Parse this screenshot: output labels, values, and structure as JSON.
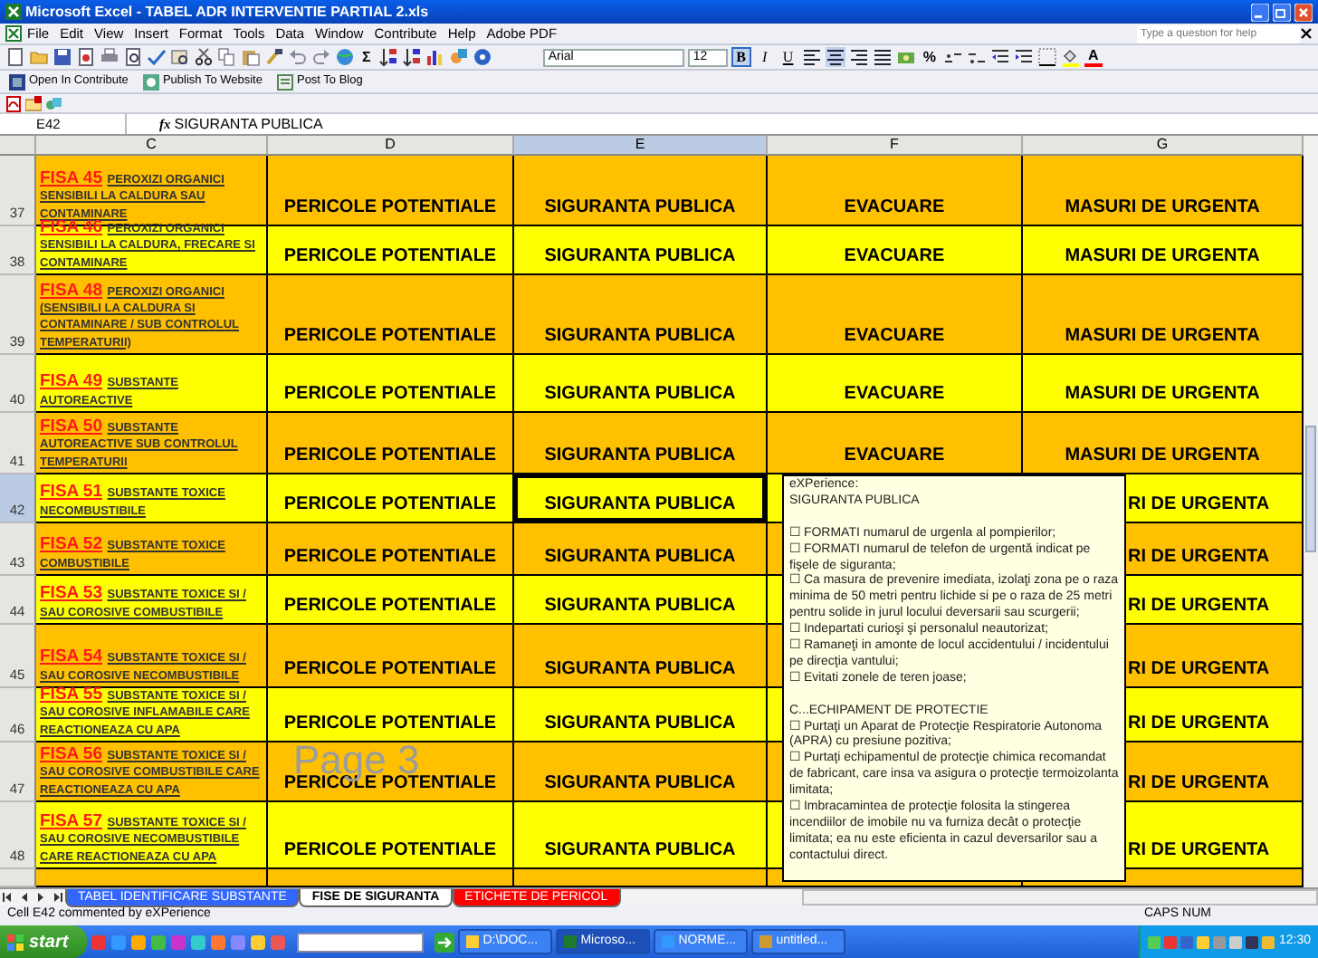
{
  "window": {
    "title": "Microsoft Excel - TABEL ADR INTERVENTIE PARTIAL 2.xls"
  },
  "menu": [
    "File",
    "Edit",
    "View",
    "Insert",
    "Format",
    "Tools",
    "Data",
    "Window",
    "Contribute",
    "Help",
    "Adobe PDF"
  ],
  "help_search": {
    "placeholder": "Type a question for help"
  },
  "toolbar": {
    "sum": "Σ",
    "font": "Arial",
    "size": "12",
    "format_buttons": [
      {
        "label": "B",
        "selected": true
      },
      {
        "label": "I",
        "selected": false
      },
      {
        "label": "U",
        "selected": false
      }
    ],
    "percent": "%",
    "font_color": "A"
  },
  "contribute_toolbar": [
    "Open In Contribute",
    "Publish To Website",
    "Post To Blog"
  ],
  "formula_bar": {
    "name_box": "E42",
    "fx": "fx",
    "value": "SIGURANTA PUBLICA"
  },
  "columns": [
    {
      "label": "C",
      "selected": false
    },
    {
      "label": "D",
      "selected": false
    },
    {
      "label": "E",
      "selected": true
    },
    {
      "label": "F",
      "selected": false
    },
    {
      "label": "G",
      "selected": false
    }
  ],
  "rows": [
    {
      "number": "37",
      "selected": false,
      "color": "#ffc000",
      "fisa": "FISA 45",
      "substance": "PEROXIZI ORGANICI SENSIBILI LA CALDURA SAU CONTAMINARE",
      "cells": [
        "PERICOLE POTENTIALE",
        "SIGURANTA PUBLICA",
        "EVACUARE",
        "MASURI DE URGENTA"
      ]
    },
    {
      "number": "38",
      "selected": false,
      "color": "#ffff00",
      "fisa": "FISA 46",
      "substance": "PEROXIZI ORGANICI SENSIBILI LA CALDURA, FRECARE SI CONTAMINARE",
      "cells": [
        "PERICOLE POTENTIALE",
        "SIGURANTA PUBLICA",
        "EVACUARE",
        "MASURI DE URGENTA"
      ]
    },
    {
      "number": "39",
      "selected": false,
      "color": "#ffc000",
      "fisa": "FISA 48",
      "substance": "PEROXIZI ORGANICI (SENSIBILI LA CALDURA SI CONTAMINARE / SUB CONTROLUL TEMPERATURII)",
      "cells": [
        "PERICOLE POTENTIALE",
        "SIGURANTA PUBLICA",
        "EVACUARE",
        "MASURI DE URGENTA"
      ]
    },
    {
      "number": "40",
      "selected": false,
      "color": "#ffff00",
      "fisa": "FISA 49",
      "substance": "SUBSTANTE AUTOREACTIVE",
      "cells": [
        "PERICOLE POTENTIALE",
        "SIGURANTA PUBLICA",
        "EVACUARE",
        "MASURI DE URGENTA"
      ]
    },
    {
      "number": "41",
      "selected": false,
      "color": "#ffc000",
      "fisa": "FISA 50",
      "substance": "SUBSTANTE AUTOREACTIVE SUB CONTROLUL TEMPERATURII",
      "cells": [
        "PERICOLE POTENTIALE",
        "SIGURANTA PUBLICA",
        "EVACUARE",
        "MASURI DE URGENTA"
      ]
    },
    {
      "number": "42",
      "selected": true,
      "color": "#ffff00",
      "fisa": "FISA 51",
      "substance": "SUBSTANTE TOXICE NECOMBUSTIBILE",
      "covered": true,
      "cells": [
        "PERICOLE POTENTIALE",
        "SIGURANTA PUBLICA",
        "",
        "RI DE URGENTA"
      ]
    },
    {
      "number": "43",
      "selected": false,
      "color": "#ffc000",
      "fisa": "FISA 52",
      "substance": "SUBSTANTE TOXICE COMBUSTIBILE",
      "covered": true,
      "cells": [
        "PERICOLE POTENTIALE",
        "SIGURANTA PUBLICA",
        "",
        "RI DE URGENTA"
      ]
    },
    {
      "number": "44",
      "selected": false,
      "color": "#ffff00",
      "fisa": "FISA 53",
      "substance": "SUBSTANTE TOXICE SI / SAU COROSIVE COMBUSTIBILE",
      "covered": true,
      "cells": [
        "PERICOLE POTENTIALE",
        "SIGURANTA PUBLICA",
        "",
        "RI DE URGENTA"
      ]
    },
    {
      "number": "45",
      "selected": false,
      "color": "#ffc000",
      "fisa": "FISA 54",
      "substance": "SUBSTANTE TOXICE SI / SAU COROSIVE NECOMBUSTIBILE",
      "covered": true,
      "cells": [
        "PERICOLE POTENTIALE",
        "SIGURANTA PUBLICA",
        "",
        "RI DE URGENTA"
      ]
    },
    {
      "number": "46",
      "selected": false,
      "color": "#ffff00",
      "fisa": "FISA 55",
      "substance": "SUBSTANTE TOXICE SI / SAU COROSIVE INFLAMABILE CARE REACTIONEAZA CU APA",
      "covered": true,
      "cells": [
        "PERICOLE POTENTIALE",
        "SIGURANTA PUBLICA",
        "",
        "RI DE URGENTA"
      ]
    },
    {
      "number": "47",
      "selected": false,
      "color": "#ffc000",
      "fisa": "FISA 56",
      "substance": "SUBSTANTE TOXICE SI / SAU COROSIVE COMBUSTIBILE CARE REACTIONEAZA CU APA",
      "covered": true,
      "cells": [
        "PERICOLE POTENTIALE",
        "SIGURANTA PUBLICA",
        "",
        "RI DE URGENTA"
      ]
    },
    {
      "number": "48",
      "selected": false,
      "color": "#ffff00",
      "fisa": "FISA 57",
      "substance": "SUBSTANTE TOXICE SI / SAU COROSIVE NECOMBUSTIBILE CARE REACTIONEAZA CU APA",
      "covered": true,
      "cells": [
        "PERICOLE POTENTIALE",
        "SIGURANTA PUBLICA",
        "",
        "RI DE URGENTA"
      ]
    }
  ],
  "page_label": "Page 3",
  "comment": {
    "blocks": [
      [
        "eXPerience:",
        "SIGURANTA PUBLICA"
      ],
      [
        "☐ FORMATI numarul de urgenla al pompierilor;",
        "☐ FORMATI numarul de telefon de urgentă indicat pe fişele de siguranta;",
        "☐ Ca masura de prevenire imediata, izolaţi zona pe o raza minima de 50 metri pentru lichide si pe o raza de 25 metri pentru solide in jurul locului deversarii sau scurgerii;",
        "☐ Indepartati curioşi şi personalul neautorizat;",
        "☐ Ramaneţi in amonte de locul accidentului / incidentului pe direcţia vantului;",
        "☐ Evitati zonele de teren joase;"
      ],
      [
        "C...ECHIPAMENT DE PROTECTIE",
        "☐ Purtaţi un Aparat de Protecţie Respiratorie Autonoma (APRA) cu presiune pozitiva;",
        "☐ Purtaţi echipamentul de protecţie chimica recomandat de fabricant, care insa va asigura o protecţie termoizolanta limitata;",
        "☐ Imbracamintea de protecţie folosita la stingerea incendiilor de imobile nu va furniza decât o protecţie limitata; ea nu este eficienta in cazul deversarilor sau a contactului direct."
      ]
    ]
  },
  "sheet_tabs": [
    {
      "label": "TABEL IDENTIFICARE SUBSTANTE",
      "selected": false,
      "color": "#3366ff"
    },
    {
      "label": "FISE DE SIGURANTA",
      "selected": true,
      "color": "#ffffff"
    },
    {
      "label": "ETICHETE DE PERICOL",
      "selected": false,
      "color": "#ff0000"
    }
  ],
  "status_bar": {
    "message": "Cell E42 commented by eXPerience",
    "indicators": [
      "CAPS",
      "NUM"
    ]
  },
  "taskbar": {
    "start": "start",
    "tasks": [
      {
        "label": "D:\\DOC...",
        "selected": false
      },
      {
        "label": "Microso...",
        "selected": true
      },
      {
        "label": "NORME...",
        "selected": false
      },
      {
        "label": "untitled...",
        "selected": false
      }
    ],
    "clock": "12:30"
  }
}
